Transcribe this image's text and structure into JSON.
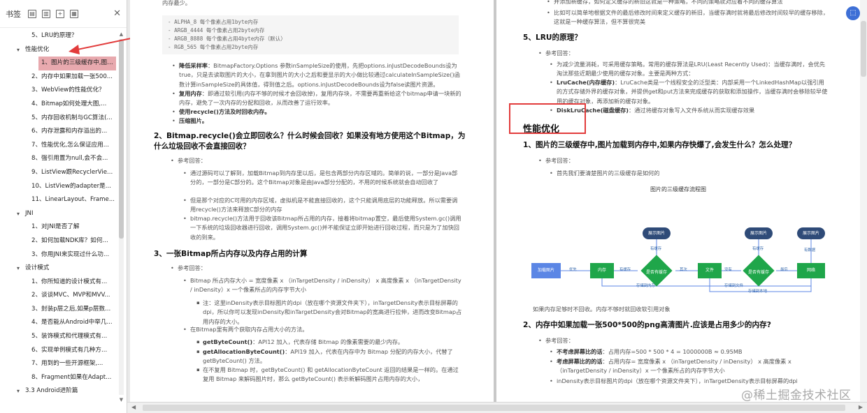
{
  "sidebar": {
    "title": "书签",
    "items": [
      {
        "label": "5、LRU的原理？",
        "level": 1
      },
      {
        "label": "性能优化",
        "level": 0
      },
      {
        "label": "1、图片的三级缓存中,图片...",
        "level": 1,
        "selected": true
      },
      {
        "label": "2、内存中如果加载一张500...",
        "level": 1
      },
      {
        "label": "3、WebView的性能优化？",
        "level": 1
      },
      {
        "label": "4、Bitmap如何处理大图,...",
        "level": 1
      },
      {
        "label": "5、内存回收机制与GC算法(...",
        "level": 1
      },
      {
        "label": "6、内存泄露和内存溢出的...",
        "level": 1
      },
      {
        "label": "7、性能优化,怎么保证应用...",
        "level": 1
      },
      {
        "label": "8、强引用置为null,会不会...",
        "level": 1
      },
      {
        "label": "9、ListView跟RecyclerVie...",
        "level": 1
      },
      {
        "label": "10、ListView的adapter是...",
        "level": 1
      },
      {
        "label": "11、LinearLayout、Frame...",
        "level": 1
      },
      {
        "label": "JNI",
        "level": 0
      },
      {
        "label": "1、对JNI是否了解",
        "level": 1
      },
      {
        "label": "2、如何加载NDK库？如何...",
        "level": 1
      },
      {
        "label": "3、你用JNI来实现过什么功...",
        "level": 1
      },
      {
        "label": "设计模式",
        "level": 0
      },
      {
        "label": "1、你所知道的设计模式有...",
        "level": 1
      },
      {
        "label": "2、谈谈MVC、MVP和MVV...",
        "level": 1
      },
      {
        "label": "3、封装p层之后,如果p层数...",
        "level": 1
      },
      {
        "label": "4、是否能从Android中举几...",
        "level": 1
      },
      {
        "label": "5、装饰模式和代理模式有...",
        "level": 1
      },
      {
        "label": "6、实现单例模式有几种方...",
        "level": 1
      },
      {
        "label": "7、用到的一些开源框架,...",
        "level": 1
      },
      {
        "label": "8、Fragment如果在Adapt...",
        "level": 1
      },
      {
        "label": "3.3 Android进阶篇",
        "level": 0
      }
    ]
  },
  "left_page": {
    "top_text": "内存最少。",
    "code_lines": [
      "- ALPHA_8    每个像素占用1byte内存",
      "- ARGB_4444  每个像素占用2byte内存",
      "- ARGB_8888  每个像素占用4byte内存（默认）",
      "- RGB_565  每个像素占用2byte内存"
    ],
    "b1_label": "降低采样率",
    "b1_text": "：BitmapFactory.Options 参数inSampleSize的使用，先把options.inJustDecodeBounds设为true，只是去读取图片的大小，在拿到图片的大小之后和要显示的大小做比较通过calculateInSampleSize()函数计算inSampleSize的具体值，得到值之后。options.inJustDecodeBounds设为false读图片资源。",
    "b2_label": "复用内存",
    "b2_text": "：即通过软引用(内存不够的时候才会回收掉)，复用内存块，不需要再重新给这个bitmap申请一块新的内存，避免了一次内存的分配和回收，从而改善了运行效率。",
    "b3_text": "使用recycle()方法及时回收内存。",
    "b4_text": "压缩图片。",
    "h2": "2、Bitmap.recycle()会立即回收么？什么时候会回收？如果没有地方使用这个Bitmap，为什么垃圾回收不会直接回收？",
    "ref1": "参考回答：",
    "s2_a": "通过源码可以了解到，加载Bitmap到内存里以后，是包含两部分内存区域的。简单的说，一部分是Java部分的，一部分是C部分的。这个Bitmap对象是由Java部分分配的，不用的时候系统就会自动回收了",
    "s2_b": "但是那个对应的C可用的内存区域，虚拟机是不能直接回收的，这个只能调用底层的功能释放。所以需要调用recycle()方法来释放C部分的内存",
    "s2_c": "bitmap.recycle()方法用于回收该Bitmap所占用的内存，接着将bitmap置空，最后使用System.gc()调用一下系统的垃圾回收器进行回收，调用System.gc()并不能保证立即开始进行回收过程，而只是为了加快回收的到来。",
    "h3": "3、一张Bitmap所占内存以及内存占用的计算",
    "ref2": "参考回答：",
    "s3_a": "Bitmap 所占内存大小 = 宽度像素 x （inTargetDensity / inDensity） x 高度像素 x （inTargetDensity / inDensity）x 一个像素所占的内存字节大小",
    "s3_b": "注：这里inDensity表示目标图片的dpi（放在哪个资源文件夹下），inTargetDensity表示目标屏幕的dpi，所以你可以发现inDensity和inTargetDensity会对Bitmap的宽高进行拉伸，进而改变Bitmap占用内存的大小。",
    "s3_c": "在Bitmap里有两个获取内存占用大小的方法。",
    "s3_d_label": "getByteCount()",
    "s3_d": "：API12 加入，代表存储 Bitmap 的像素需要的最少内存。",
    "s3_e_label": "getAllocationByteCount()",
    "s3_e": "：API19 加入，代表在内存中为 Bitmap 分配的内存大小，代替了 getByteCount() 方法。",
    "s3_f": "在不复用 Bitmap 时，getByteCount() 和 getAllocationByteCount 返回的结果是一样的。在通过复用 Bitmap 来解码图片时，那么 getByteCount() 表示新解码图片占用内存的大小，"
  },
  "right_page": {
    "top_a": "并添加新缓存，如何定义缓存的新旧这就是一种策略，不同的策略就对应着不同的缓存算法",
    "top_b": "比如可以简单地根据文件的最后修改时间来定义缓存的新旧，当缓存满时就将最后修改时间较早的缓存移除，这就是一种缓存算法，但不算很完美",
    "h5": "5、LRU的原理？",
    "ref": "参考回答：",
    "lru_a": "为减少流量消耗，可采用缓存策略。常用的缓存算法是LRU(Least Recently Used)：当缓存满时，会优先淘汰那些近期最少使用的缓存对象。主要是两种方式：",
    "lru_b_label": "LruCache(内存缓存)",
    "lru_b": "：LruCache类是一个线程安全的泛型类：内部采用一个LinkedHashMap以强引用的方式存储外界的缓存对象，并提供get和put方法来完成缓存的获取和添加操作，当缓存满时会移除较早使用的缓存对象，再添加新的缓存对象。",
    "lru_c_label": "DiskLruCache(磁盘缓存)",
    "lru_c": "：通过将缓存对象写入文件系统从而实现缓存效果",
    "section": "性能优化",
    "h1": "1、图片的三级缓存中,图片加载到内存中,如果内存快爆了,会发生什么？怎么处理？",
    "ref_b": "参考回答：",
    "p1": "首先我们要清楚图片的三级缓存是如何的",
    "diagram_title": "图片的三级缓存流程图",
    "diagram": {
      "n_load": "加载图片",
      "n_mem": "内存",
      "n_memq": "是否有缓存",
      "n_file": "文件",
      "n_fileq": "是否有缓存",
      "n_net": "网络",
      "n_show": "展示图片",
      "l_cache": "有缓存",
      "l_cache2": "有缓存",
      "l_data": "有数据",
      "l_first": "优先",
      "l_no": "没有",
      "l_other": "其次",
      "l_last": "最后",
      "l_save_mem": "存储到内存",
      "l_save_file": "存储到文件",
      "l_save_local": "存储到本地"
    },
    "p2": "如果内存足够时不回收。内存不够时就回收软引用对象",
    "h2": "2、内存中如果加载一张500*500的png高清图片.应该是占用多少的内存?",
    "ref_c": "参考回答：",
    "m_a_label": "不考虑屏幕比的话",
    "m_a": "：占用内存=500 * 500 * 4 = 1000000B ≈ 0.95MB",
    "m_b_label": "考虑屏幕比的的话",
    "m_b": "：占用内存= 宽度像素 x （inTargetDensity / inDensity） x 高度像素 x （inTargetDensity / inDensity）x 一个像素所占的内存字节大小",
    "m_c": "inDensity表示目标图片的dpi（放在哪个资源文件夹下），inTargetDensity表示目标屏幕的dpi"
  },
  "watermark": "@稀土掘金技术社区",
  "colors": {
    "accent_red": "#e23b3b",
    "selected": "#e8a9ae",
    "green": "#1fa64a",
    "blue": "#5b86e5",
    "navy": "#2f4b78"
  }
}
